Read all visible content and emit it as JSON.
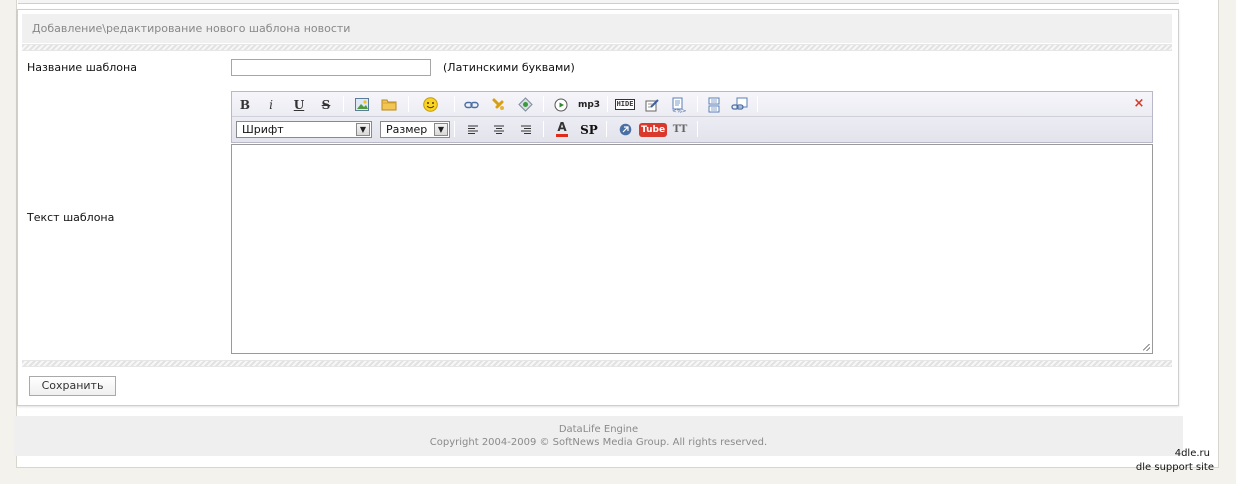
{
  "panel": {
    "title": "Добавление\\редактирование нового шаблона новости"
  },
  "form": {
    "name_label": "Название шаблона",
    "name_value": "",
    "name_hint": "(Латинскими буквами)",
    "text_label": "Текст шаблона",
    "text_value": ""
  },
  "toolbar": {
    "row1": [
      "bold-icon",
      "italic-icon",
      "underline-icon",
      "strikethrough-icon",
      "image-icon",
      "folder-icon",
      "smiley-icon",
      "link-icon",
      "leech-link-icon",
      "email-icon",
      "video-icon",
      "mp3-icon",
      "hide-icon",
      "quote-icon",
      "code-icon",
      "page-break-icon",
      "page-link-icon",
      "close-icon"
    ],
    "bold": "B",
    "italic": "i",
    "underline": "U",
    "strike": "S",
    "mp3": "mp3",
    "hide": "HIDE",
    "close": "×",
    "font_select": "Шрифт",
    "size_select": "Размер",
    "color_label": "A",
    "spoiler_label": "SP",
    "youtube_label": "Tube",
    "translit_label": "TT"
  },
  "buttons": {
    "save": "Сохранить"
  },
  "footer": {
    "line1": "DataLife Engine",
    "line2": "Copyright 2004-2009 © SoftNews Media Group. All rights reserved."
  },
  "corner": {
    "link": "4dle.ru",
    "caption": "dle support site"
  },
  "colors": {
    "background": "#f3f2ec",
    "panel_header": "#f0f0f0",
    "close_red": "#d23b2a",
    "youtube_red": "#d9382b"
  }
}
